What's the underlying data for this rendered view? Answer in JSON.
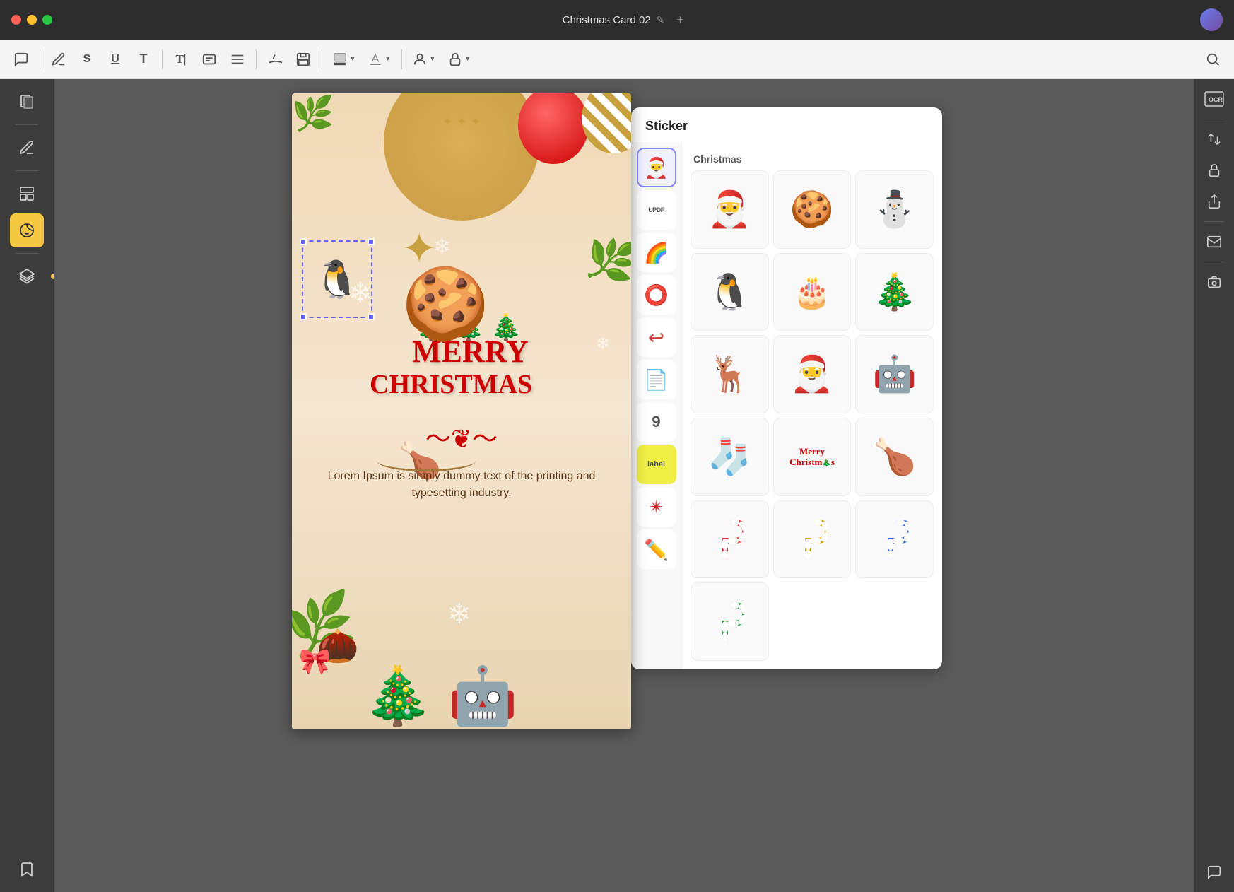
{
  "titlebar": {
    "title": "Christmas Card 02",
    "edit_icon": "✎",
    "add_tab_label": "+",
    "close_btn": "✕",
    "minimize_btn": "−",
    "maximize_btn": "+"
  },
  "toolbar": {
    "comment_icon": "💬",
    "pencil_icon": "✏️",
    "strikethrough_icon": "S̶",
    "underline_icon": "U",
    "text_icon": "T",
    "text_cursor_icon": "T|",
    "text_align_icon": "≡",
    "pen_icon": "✒",
    "save_icon": "💾",
    "color_label": "■",
    "highlight_label": "◆",
    "user_icon": "👤",
    "lock_icon": "🔒",
    "search_icon": "🔍"
  },
  "left_sidebar": {
    "items": [
      {
        "name": "pages",
        "icon": "📄"
      },
      {
        "name": "annotations",
        "icon": "📝"
      },
      {
        "name": "templates",
        "icon": "🗒"
      },
      {
        "name": "stickers",
        "icon": "🖼",
        "active": true
      },
      {
        "name": "layers",
        "icon": "⧉"
      },
      {
        "name": "bookmarks",
        "icon": "🔖"
      }
    ]
  },
  "sticker_panel": {
    "title": "Sticker",
    "section_label": "Christmas",
    "categories": [
      {
        "name": "christmas",
        "emoji": "🎅",
        "active": true
      },
      {
        "name": "updf",
        "label": "UPDF"
      },
      {
        "name": "emoji",
        "emoji": "🌈"
      },
      {
        "name": "shapes",
        "emoji": "⭕"
      },
      {
        "name": "arrows",
        "emoji": "↩"
      },
      {
        "name": "paper",
        "emoji": "📄"
      },
      {
        "name": "numbers",
        "emoji": "9"
      },
      {
        "name": "labels",
        "emoji": "🏷"
      },
      {
        "name": "stars",
        "emoji": "✴"
      },
      {
        "name": "pencil",
        "emoji": "✏"
      }
    ],
    "stickers": [
      {
        "id": 1,
        "emoji": "🎅",
        "label": "Santa Claus"
      },
      {
        "id": 2,
        "emoji": "🍪",
        "label": "Gingerbread Man"
      },
      {
        "id": 3,
        "emoji": "⛄",
        "label": "Snowman"
      },
      {
        "id": 4,
        "emoji": "🐧",
        "label": "Christmas Penguin"
      },
      {
        "id": 5,
        "emoji": "🎂",
        "label": "Christmas Pudding"
      },
      {
        "id": 6,
        "emoji": "🎄",
        "label": "Christmas Tree"
      },
      {
        "id": 7,
        "emoji": "🦌",
        "label": "Reindeer"
      },
      {
        "id": 8,
        "emoji": "🎅",
        "label": "Christmas Hat"
      },
      {
        "id": 9,
        "emoji": "🤖",
        "label": "Nutcracker Soldier"
      },
      {
        "id": 10,
        "emoji": "🧦",
        "label": "Christmas Stocking"
      },
      {
        "id": 11,
        "emoji": "🎄",
        "label": "Merry Christmas Text"
      },
      {
        "id": 12,
        "emoji": "🍗",
        "label": "Turkey/Chicken"
      },
      {
        "id": 13,
        "emoji": "🍬",
        "label": "Candy Cane Red"
      },
      {
        "id": 14,
        "emoji": "🍬",
        "label": "Candy Cane Yellow"
      },
      {
        "id": 15,
        "emoji": "🍬",
        "label": "Candy Cane Blue"
      },
      {
        "id": 16,
        "emoji": "🍬",
        "label": "Candy Cane Green"
      }
    ]
  },
  "canvas": {
    "card_title": "MERRY",
    "card_subtitle": "CHRISTMAS",
    "lorem_text": "Lorem Ipsum is simply dummy text of the printing and typesetting industry.",
    "selected_sticker": "Christmas Penguin"
  },
  "right_sidebar": {
    "items": [
      {
        "name": "ocr",
        "label": "OCR"
      },
      {
        "name": "convert",
        "icon": "⇄"
      },
      {
        "name": "protect",
        "icon": "🔒"
      },
      {
        "name": "share",
        "icon": "⬆"
      },
      {
        "name": "email",
        "icon": "✉"
      },
      {
        "name": "snapshot",
        "icon": "📷"
      },
      {
        "name": "chat",
        "icon": "💬"
      }
    ]
  }
}
